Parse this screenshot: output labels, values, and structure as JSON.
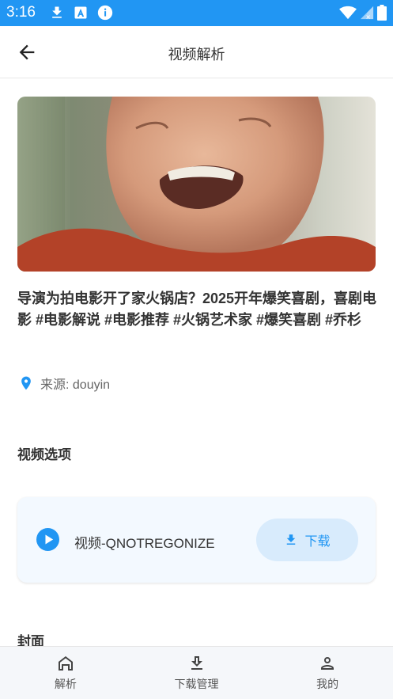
{
  "status_bar": {
    "time": "3:16",
    "icons": [
      "download-icon",
      "a-badge-icon",
      "info-icon",
      "wifi-icon",
      "signal-icon",
      "battery-icon"
    ]
  },
  "app_bar": {
    "title": "视频解析",
    "back_icon": "arrow-back-icon"
  },
  "video": {
    "title": "导演为拍电影开了家火锅店？2025开年爆笑喜剧，喜剧电影 #电影解说 #电影推荐 #火锅艺术家 #爆笑喜剧 #乔杉",
    "source": "来源: douyin"
  },
  "sections": {
    "options_title": "视频选项",
    "cover_title": "封面"
  },
  "options": [
    {
      "label": "视频-QNOTREGONIZE",
      "button": "下载"
    }
  ],
  "bottom_nav": [
    {
      "label": "解析",
      "icon": "home-icon"
    },
    {
      "label": "下载管理",
      "icon": "download-icon"
    },
    {
      "label": "我的",
      "icon": "person-icon"
    }
  ],
  "colors": {
    "primary": "#2196f3",
    "card_bg": "#f3f9ff",
    "button_bg": "#d8ebfc"
  }
}
